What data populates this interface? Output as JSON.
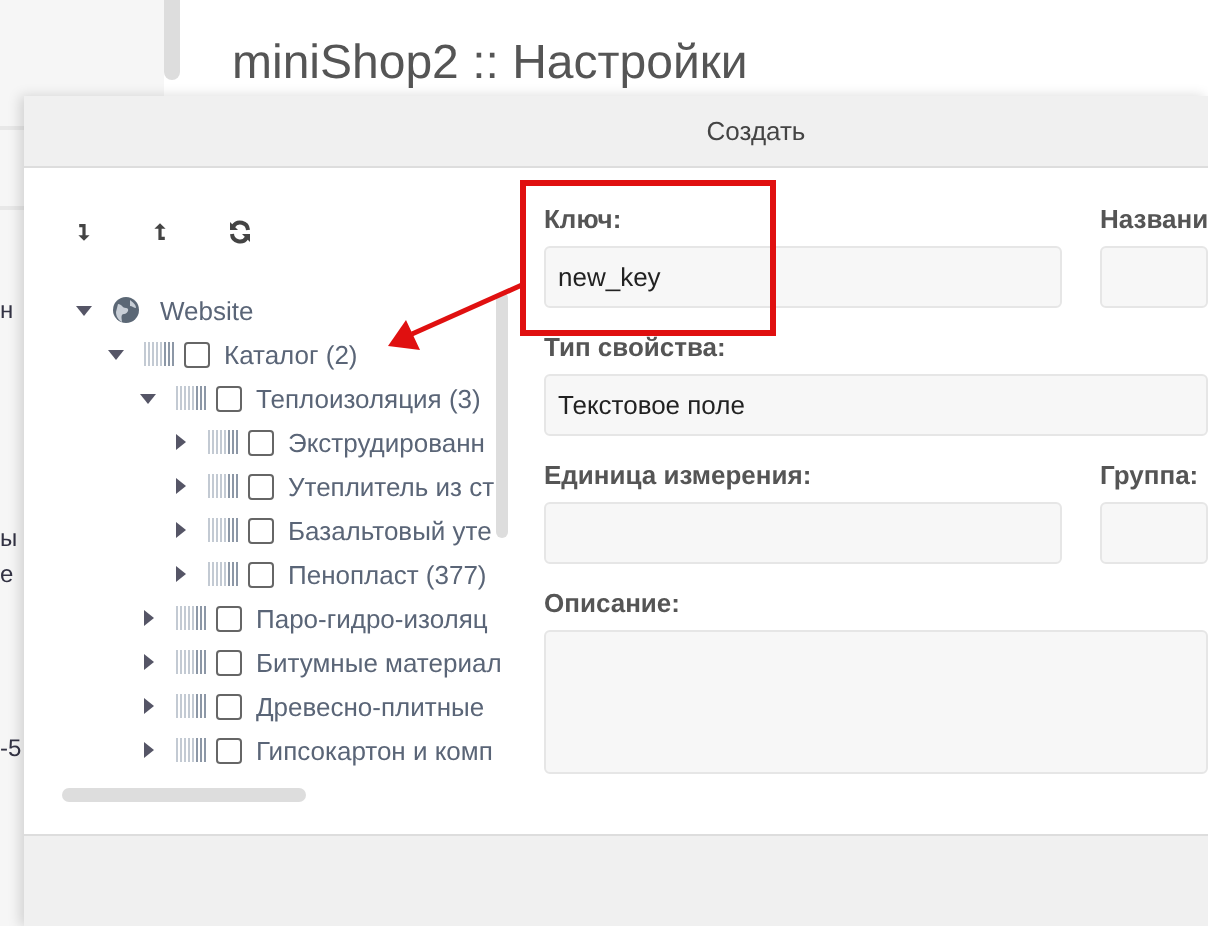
{
  "page": {
    "title": "miniShop2 :: Настройки",
    "background_fragments": [
      {
        "text": "н"
      },
      {
        "text": "ы"
      },
      {
        "text": "е"
      },
      {
        "text": "-5"
      }
    ]
  },
  "dialog": {
    "title": "Создать",
    "tree_toolbar": [
      {
        "kind": "expand"
      },
      {
        "kind": "collapse"
      },
      {
        "kind": "refresh"
      }
    ],
    "tree": [
      {
        "kind": "site",
        "label": "Website",
        "expanded": true,
        "children": [
          {
            "kind": "category",
            "label": "Каталог (2)",
            "expanded": true,
            "checked": false,
            "children": [
              {
                "kind": "category",
                "label": "Теплоизоляция (3)",
                "expanded": true,
                "checked": false,
                "children": [
                  {
                    "kind": "category",
                    "label": "Экструдированн",
                    "expanded": false,
                    "checked": false
                  },
                  {
                    "kind": "category",
                    "label": "Утеплитель из ст",
                    "expanded": false,
                    "checked": false
                  },
                  {
                    "kind": "category",
                    "label": "Базальтовый уте",
                    "expanded": false,
                    "checked": false
                  },
                  {
                    "kind": "category",
                    "label": "Пенопласт (377)",
                    "expanded": false,
                    "checked": false
                  }
                ]
              },
              {
                "kind": "category",
                "label": "Паро-гидро-изоляц",
                "expanded": false,
                "checked": false
              },
              {
                "kind": "category",
                "label": "Битумные материал",
                "expanded": false,
                "checked": false
              },
              {
                "kind": "category",
                "label": "Древесно-плитные",
                "expanded": false,
                "checked": false
              },
              {
                "kind": "category",
                "label": "Гипсокартон и комп",
                "expanded": false,
                "checked": false
              }
            ]
          }
        ]
      }
    ],
    "form": {
      "key": {
        "label": "Ключ:",
        "value": "new_key"
      },
      "name": {
        "label": "Названи"
      },
      "type": {
        "label": "Тип свойства:",
        "value": "Текстовое поле"
      },
      "unit": {
        "label": "Единица измерения:"
      },
      "group": {
        "label": "Группа:"
      },
      "description": {
        "label": "Описание:"
      }
    }
  },
  "annotation": {
    "highlight": true,
    "arrow": true
  }
}
